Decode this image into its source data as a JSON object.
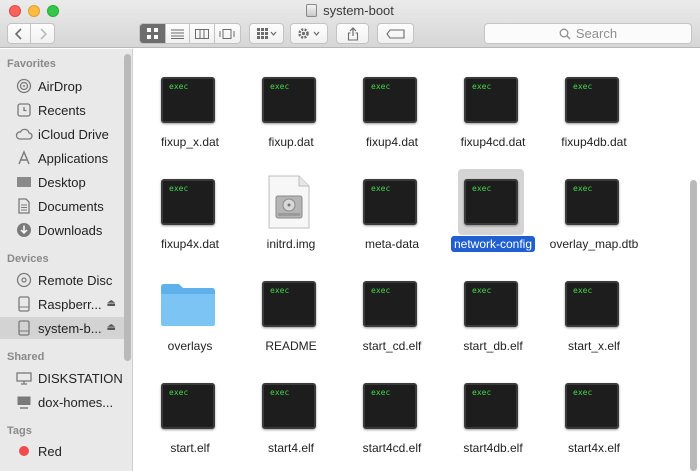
{
  "window": {
    "title": "system-boot"
  },
  "toolbar": {
    "search_placeholder": "Search"
  },
  "sidebar": {
    "favorites_header": "Favorites",
    "favorites": [
      {
        "label": "AirDrop",
        "icon": "airdrop-icon"
      },
      {
        "label": "Recents",
        "icon": "recents-icon"
      },
      {
        "label": "iCloud Drive",
        "icon": "cloud-icon"
      },
      {
        "label": "Applications",
        "icon": "applications-icon"
      },
      {
        "label": "Desktop",
        "icon": "desktop-icon"
      },
      {
        "label": "Documents",
        "icon": "documents-icon"
      },
      {
        "label": "Downloads",
        "icon": "downloads-icon"
      }
    ],
    "devices_header": "Devices",
    "devices": [
      {
        "label": "Remote Disc",
        "icon": "disc-icon"
      },
      {
        "label": "Raspberr...",
        "icon": "drive-icon",
        "eject": true
      },
      {
        "label": "system-b...",
        "icon": "drive-icon",
        "eject": true,
        "selected": true
      }
    ],
    "shared_header": "Shared",
    "shared": [
      {
        "label": "DISKSTATION",
        "icon": "server-icon"
      },
      {
        "label": "dox-homes...",
        "icon": "computer-icon"
      }
    ],
    "tags_header": "Tags",
    "tags": [
      {
        "label": "Red",
        "color": "#f04b4b"
      }
    ]
  },
  "files": [
    {
      "name": "fixup_x.dat",
      "kind": "exec"
    },
    {
      "name": "fixup.dat",
      "kind": "exec"
    },
    {
      "name": "fixup4.dat",
      "kind": "exec"
    },
    {
      "name": "fixup4cd.dat",
      "kind": "exec"
    },
    {
      "name": "fixup4db.dat",
      "kind": "exec"
    },
    {
      "name": "fixup4x.dat",
      "kind": "exec"
    },
    {
      "name": "initrd.img",
      "kind": "disk-image"
    },
    {
      "name": "meta-data",
      "kind": "exec"
    },
    {
      "name": "network-config",
      "kind": "exec",
      "selected": true
    },
    {
      "name": "overlay_map.dtb",
      "kind": "exec"
    },
    {
      "name": "overlays",
      "kind": "folder"
    },
    {
      "name": "README",
      "kind": "exec"
    },
    {
      "name": "start_cd.elf",
      "kind": "exec"
    },
    {
      "name": "start_db.elf",
      "kind": "exec"
    },
    {
      "name": "start_x.elf",
      "kind": "exec"
    },
    {
      "name": "start.elf",
      "kind": "exec"
    },
    {
      "name": "start4.elf",
      "kind": "exec"
    },
    {
      "name": "start4cd.elf",
      "kind": "exec"
    },
    {
      "name": "start4db.elf",
      "kind": "exec"
    },
    {
      "name": "start4x.elf",
      "kind": "exec"
    }
  ],
  "exec_badge": "exec",
  "colors": {
    "selection": "#1f5fd0",
    "tag_red": "#f04b4b"
  }
}
